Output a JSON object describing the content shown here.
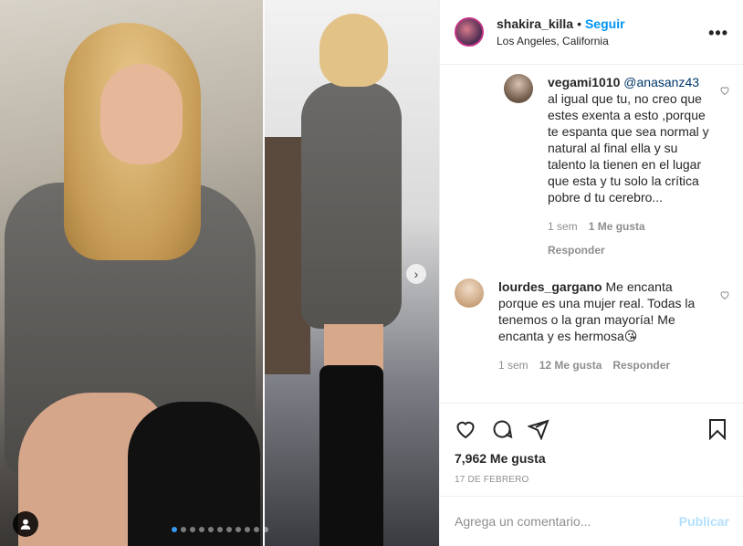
{
  "header": {
    "username": "shakira_killa",
    "separator": "•",
    "follow_label": "Seguir",
    "location": "Los Angeles, California",
    "more_label": "•••"
  },
  "comments": [
    {
      "username": "vegami1010",
      "mention": "@anasanz43",
      "text": "al igual que tu, no creo que estes exenta a esto ,porque te espanta que sea normal y natural al final ella y su talento la tienen en el lugar que esta y tu solo la crítica pobre d tu cerebro...",
      "time": "1 sem",
      "likes": "1 Me gusta",
      "reply_label": "Responder"
    },
    {
      "username": "lourdes_gargano",
      "text": "Me encanta porque es una mujer real. Todas la tenemos o la gran mayoría! Me encanta y es hermosa😘",
      "time": "1 sem",
      "likes": "12 Me gusta",
      "reply_label": "Responder"
    }
  ],
  "post": {
    "likes_count": "7,962 Me gusta",
    "date": "17 de febrero"
  },
  "composer": {
    "placeholder": "Agrega un comentario...",
    "publish_label": "Publicar"
  },
  "carousel": {
    "total": 11,
    "active_index": 0
  },
  "icons": [
    "heart-icon",
    "comment-icon",
    "share-icon",
    "bookmark-icon",
    "user-tag-icon",
    "chevron-right-icon",
    "more-icon"
  ],
  "colors": {
    "accent": "#0095f6",
    "publish_disabled": "#b2dffc",
    "mention": "#00376b"
  }
}
